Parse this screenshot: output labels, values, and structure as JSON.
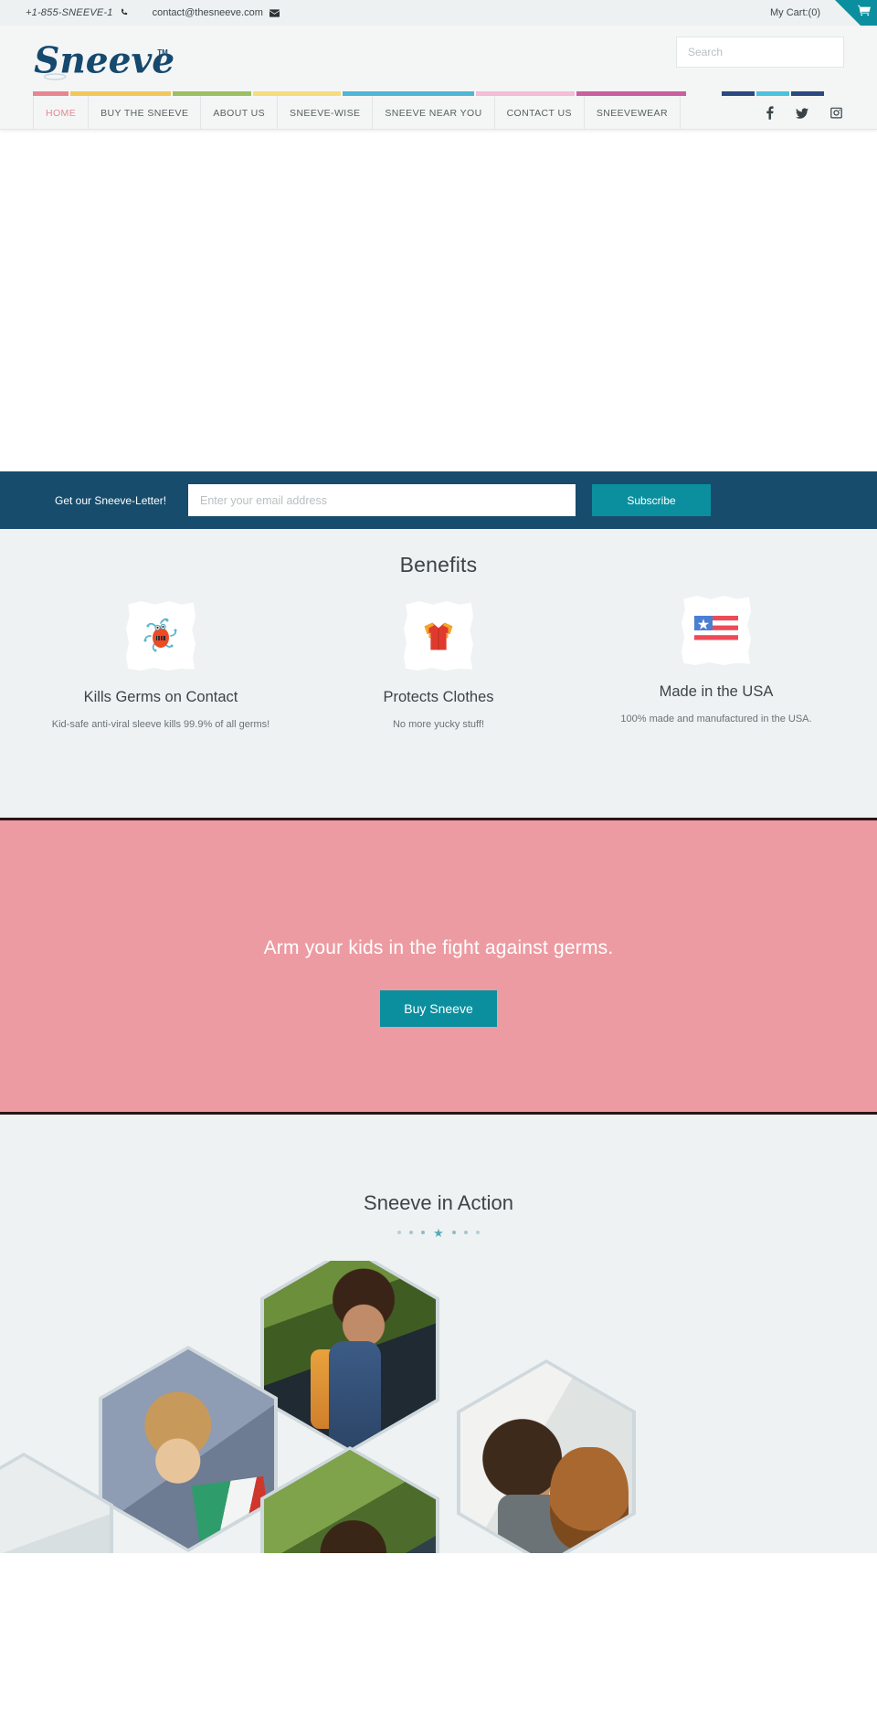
{
  "topbar": {
    "phone": "+1-855-SNEEVE-1",
    "phone_icon": "phone-icon",
    "email": "contact@thesneeve.com",
    "email_icon": "envelope-icon",
    "cart_label": "My Cart:(0)",
    "cart_icon": "shopping-cart-icon",
    "accent_teal": "#0b8f9e"
  },
  "header": {
    "brand": "Sneeve",
    "brand_tm": "TM",
    "brand_color": "#16496e",
    "search": {
      "placeholder": "Search",
      "value": "",
      "icon": "search-icon"
    }
  },
  "nav": {
    "items": [
      {
        "label": "HOME",
        "active": true,
        "color": "#e8868f"
      },
      {
        "label": "BUY THE SNEEVE",
        "active": false,
        "color": "#f2c75c"
      },
      {
        "label": "ABOUT US",
        "active": false,
        "color": "#9cbf62"
      },
      {
        "label": "SNEEVE-WISE",
        "active": false,
        "color": "#f6dd7b"
      },
      {
        "label": "SNEEVE NEAR YOU",
        "active": false,
        "color": "#4fb6d4"
      },
      {
        "label": "CONTACT US",
        "active": false,
        "color": "#f5bcd7"
      },
      {
        "label": "SNEEVEWEAR",
        "active": false,
        "color": "#c9609f"
      }
    ],
    "social": [
      {
        "name": "facebook",
        "glyph": "f",
        "bar_color": "#2c4a80"
      },
      {
        "name": "twitter",
        "glyph": "t",
        "bar_color": "#4cc2dd"
      },
      {
        "name": "instagram",
        "glyph": "i",
        "bar_color": "#2c4a80"
      }
    ]
  },
  "newsletter": {
    "label": "Get our Sneeve-Letter!",
    "placeholder": "Enter your email address",
    "value": "",
    "button": "Subscribe",
    "background": "#174c6d",
    "button_color": "#0b8f9e"
  },
  "benefits": {
    "title": "Benefits",
    "items": [
      {
        "icon": "germ-icon",
        "title": "Kills Germs on Contact",
        "desc": "Kid-safe anti-viral sleeve kills 99.9% of all germs!"
      },
      {
        "icon": "shirt-icon",
        "title": "Protects Clothes",
        "desc": "No more yucky stuff!"
      },
      {
        "icon": "usa-flag-icon",
        "title": "Made in the USA",
        "desc": "100% made and manufactured in the USA."
      }
    ]
  },
  "cta": {
    "headline": "Arm your kids in the fight against germs.",
    "button": "Buy Sneeve",
    "background": "#ed9ba2",
    "button_color": "#0b8f9e"
  },
  "gallery": {
    "title": "Sneeve in Action",
    "dots": [
      {
        "type": "dot"
      },
      {
        "type": "dot"
      },
      {
        "type": "dot"
      },
      {
        "type": "star",
        "glyph": "★"
      },
      {
        "type": "dot"
      },
      {
        "type": "dot"
      },
      {
        "type": "dot"
      }
    ],
    "photos": [
      {
        "alt": "girl-at-desk"
      },
      {
        "alt": "boy-peace-sign-backpack"
      },
      {
        "alt": "boy-with-dog"
      },
      {
        "alt": "child-leaning"
      },
      {
        "alt": "partial-photo-left"
      }
    ]
  }
}
